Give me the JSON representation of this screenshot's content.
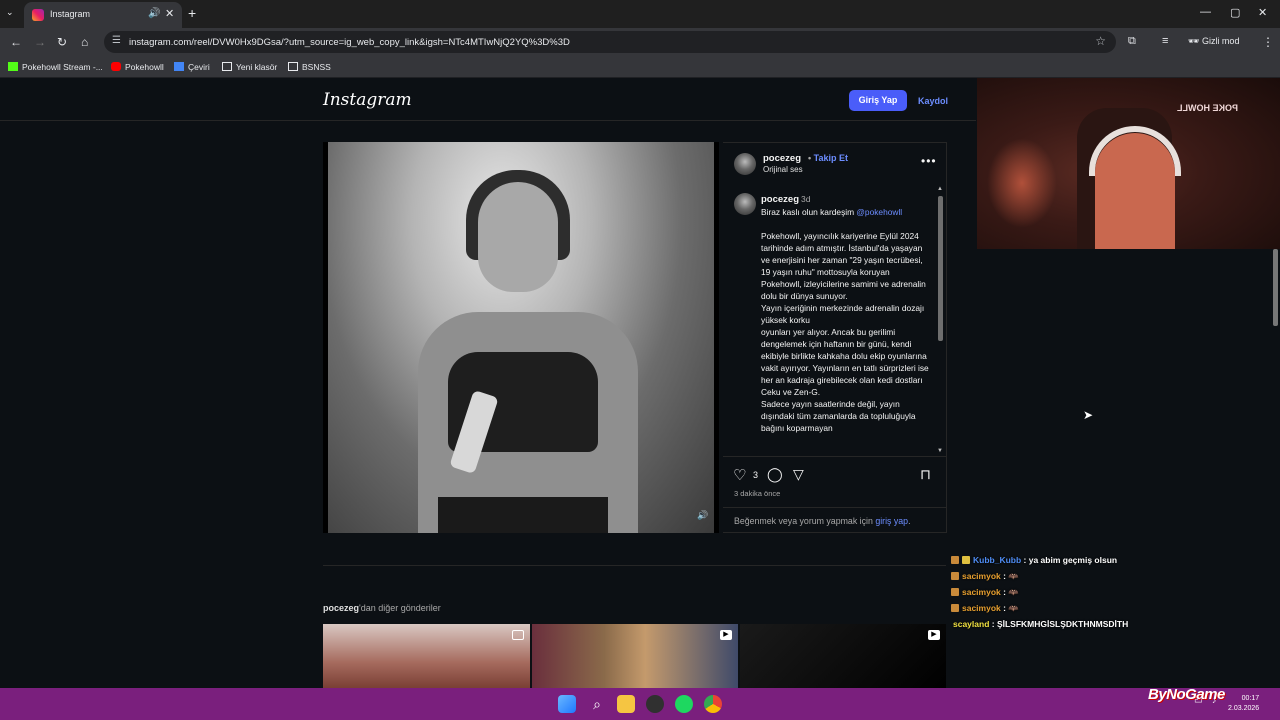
{
  "browser": {
    "tab_title": "Instagram",
    "url": "instagram.com/reel/DVW0Hx9DGsa/?utm_source=ig_web_copy_link&igsh=NTc4MTIwNjQ2YQ%3D%3D",
    "incognito_label": "Gizli mod",
    "bookmarks": [
      "Pokehowll Stream -...",
      "Pokehowll",
      "Çeviri",
      "Yeni klasör",
      "BSNSS"
    ]
  },
  "instagram": {
    "logo": "Instagram",
    "login_button": "Giriş Yap",
    "signup_link": "Kaydol",
    "post": {
      "author": "pocezeg",
      "follow_separator": "•",
      "follow_label": "Takip Et",
      "audio": "Orijinal ses",
      "more": "•••",
      "caption_author": "pocezeg",
      "caption_time": "3d",
      "caption_first_line": "Biraz kaslı olun kardeşim",
      "caption_mention": "@pokehowll",
      "caption_body": [
        "Pokehowll, yayıncılık kariyerine Eylül 2024 tarihinde adım atmıştır. İstanbul'da yaşayan ve enerjisini her zaman \"29 yaşın tecrübesi, 19 yaşın ruhu\" mottosuyla koruyan Pokehowll, izleyicilerine samimi ve adrenalin dolu bir dünya sunuyor.",
        "Yayın içeriğinin merkezinde adrenalin dozajı yüksek korku",
        "oyunları yer alıyor. Ancak bu gerilimi dengelemek için haftanın bir günü, kendi ekibiyle birlikte kahkaha dolu ekip oyunlarına vakit ayırıyor. Yayınların en tatlı sürprizleri ise her an kadraja girebilecek olan kedi dostları Ceku ve Zen-G.",
        "Sadece yayın saatlerinde değil, yayın dışındaki tüm zamanlarda da topluluğuyla bağını koparmayan"
      ],
      "like_count": "3",
      "time_ago": "3 dakika önce",
      "login_prompt_prefix": "Beğenmek veya yorum yapmak için",
      "login_prompt_link": "giriş yap",
      "login_prompt_suffix": "."
    },
    "more_posts_user": "pocezeg",
    "more_posts_suffix": "'dan diğer gönderiler"
  },
  "stream": {
    "cam_sign": "POKE HOWLL",
    "chat": [
      {
        "user": "Kubb_Kubb",
        "color": "#4f8df5",
        "message": ": ya abim geçmiş olsun"
      },
      {
        "user": "sacimyok",
        "color": "#e8a030",
        "message": ": 🦇"
      },
      {
        "user": "sacimyok",
        "color": "#e8a030",
        "message": ": 🦇"
      },
      {
        "user": "sacimyok",
        "color": "#e8a030",
        "message": ": 🦇"
      },
      {
        "user": "scayland",
        "color": "#f0e040",
        "message": ": ŞİLSFKMHGİSLŞDKTHNMSDİTH"
      }
    ],
    "watermark": "ByNoGame"
  },
  "taskbar": {
    "time": "00:17",
    "date": "2.03.2026"
  },
  "colors": {
    "ig_background": "#0c1014",
    "ig_blue": "#4a5df9",
    "link_blue": "#6c8dff",
    "taskbar": "#7a1f7d"
  }
}
